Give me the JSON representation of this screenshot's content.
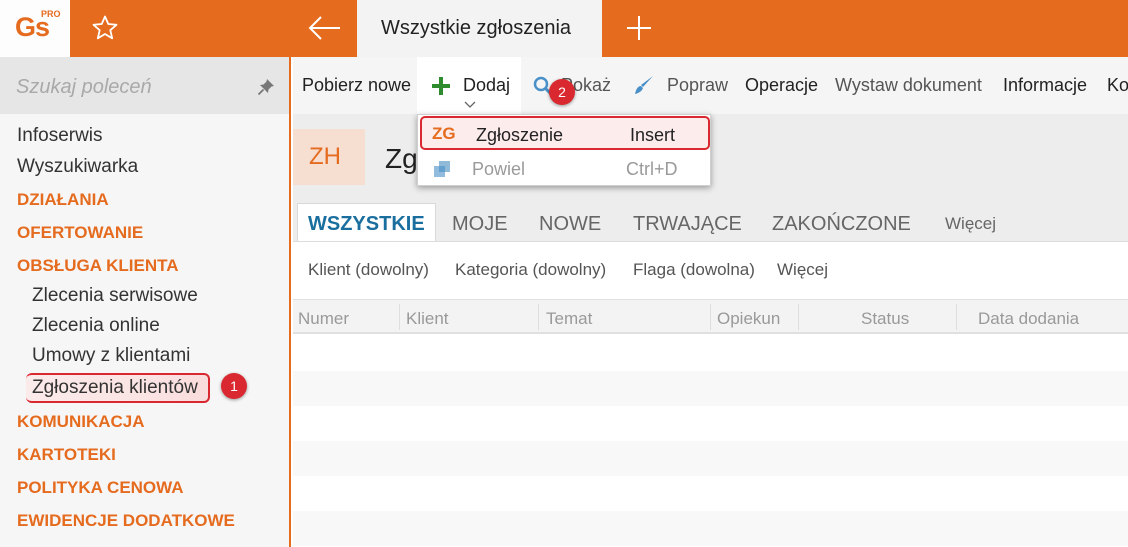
{
  "app": {
    "logo": "Gs",
    "logo_badge": "PRO",
    "active_tab": "Wszystkie zgłoszenia"
  },
  "sidebar": {
    "search_placeholder": "Szukaj poleceń",
    "items": [
      {
        "label": "Infoserwis",
        "type": "item"
      },
      {
        "label": "Wyszukiwarka",
        "type": "item"
      },
      {
        "label": "DZIAŁANIA",
        "type": "section"
      },
      {
        "label": "OFERTOWANIE",
        "type": "section"
      },
      {
        "label": "OBSŁUGA KLIENTA",
        "type": "section"
      },
      {
        "label": "Zlecenia serwisowe",
        "type": "sub"
      },
      {
        "label": "Zlecenia online",
        "type": "sub"
      },
      {
        "label": "Umowy z klientami",
        "type": "sub"
      },
      {
        "label": "Zgłoszenia klientów",
        "type": "sub",
        "selected": true
      },
      {
        "label": "KOMUNIKACJA",
        "type": "section"
      },
      {
        "label": "KARTOTEKI",
        "type": "section"
      },
      {
        "label": "POLITYKA CENOWA",
        "type": "section"
      },
      {
        "label": "EWIDENCJE DODATKOWE",
        "type": "section"
      }
    ],
    "step_badge": "1"
  },
  "toolbar": {
    "items": [
      "Pobierz nowe",
      "Dodaj",
      "Pokaż",
      "Popraw",
      "Operacje",
      "Wystaw dokument",
      "Informacje",
      "Ko"
    ],
    "step_badge": "2"
  },
  "dropdown": {
    "items": [
      {
        "abbr": "ZG",
        "label": "Zgłoszenie",
        "shortcut": "Insert"
      },
      {
        "label": "Powiel",
        "shortcut": "Ctrl+D"
      }
    ]
  },
  "header": {
    "badge": "ZH",
    "title": "Zg"
  },
  "tabs": [
    "WSZYSTKIE",
    "MOJE",
    "NOWE",
    "TRWAJĄCE",
    "ZAKOŃCZONE",
    "Więcej"
  ],
  "filters": [
    "Klient (dowolny)",
    "Kategoria (dowolny)",
    "Flaga (dowolna)",
    "Więcej"
  ],
  "table": {
    "columns": [
      "Numer",
      "Klient",
      "Temat",
      "Opiekun",
      "Status",
      "Data dodania"
    ],
    "rows": []
  },
  "colors": {
    "accent": "#e56b1f",
    "highlight": "#d9282f",
    "tab_active": "#1a6f9e"
  }
}
